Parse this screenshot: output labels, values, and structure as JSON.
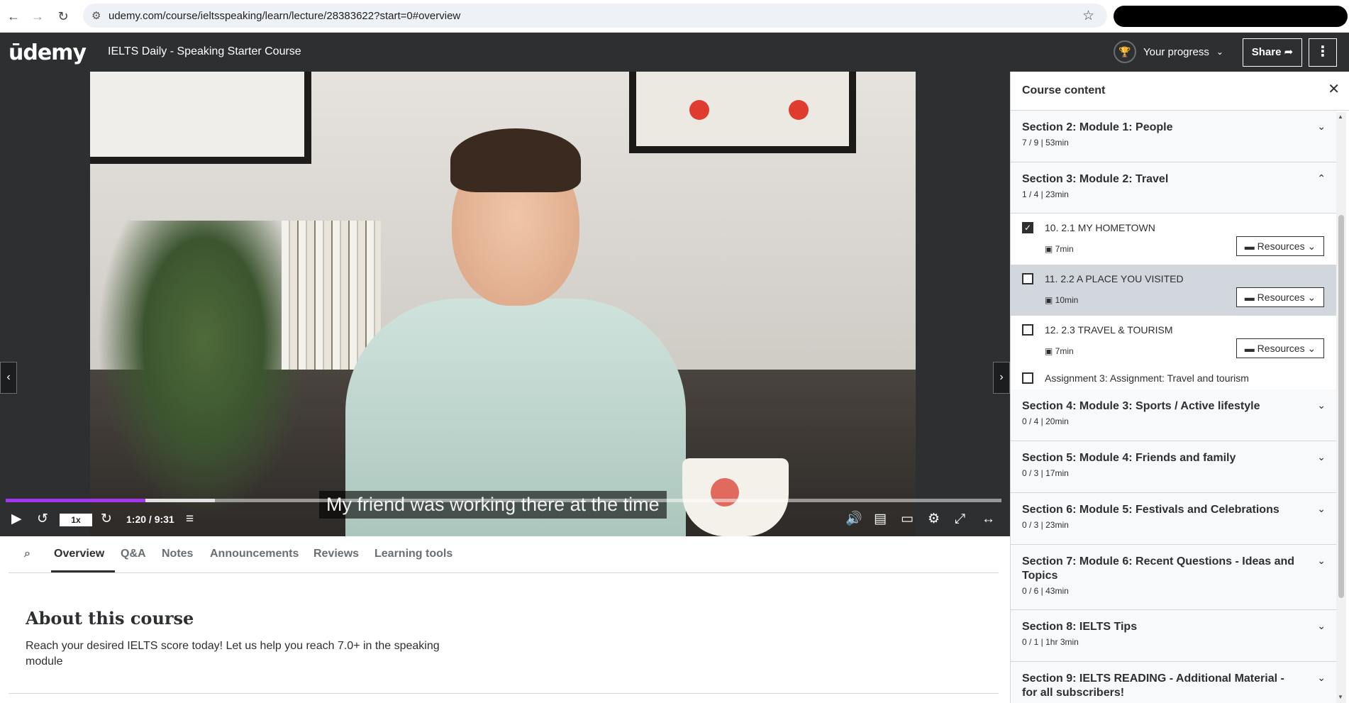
{
  "browser": {
    "url": "udemy.com/course/ieltsspeaking/learn/lecture/28383622?start=0#overview"
  },
  "header": {
    "logo": "ūdemy",
    "course_title": "IELTS Daily - Speaking Starter Course",
    "progress_label": "Your progress",
    "share_label": "Share",
    "more_label": "⋮"
  },
  "player": {
    "subtitle": "My friend was working there at the time",
    "speed": "1x",
    "time": "1:20 / 9:31",
    "progress_fraction": 0.14,
    "buffer_fraction": 0.21
  },
  "tabs": [
    "Overview",
    "Q&A",
    "Notes",
    "Announcements",
    "Reviews",
    "Learning tools"
  ],
  "about": {
    "title": "About this course",
    "text": "Reach your desired IELTS score today! Let us help you reach 7.0+ in the speaking module"
  },
  "sidebar": {
    "title": "Course content",
    "sections": [
      {
        "title": "Section 2: Module 1: People",
        "sub": "7 / 9 | 53min",
        "expanded": false
      },
      {
        "title": "Section 3: Module 2: Travel",
        "sub": "1 / 4 | 23min",
        "expanded": true
      },
      {
        "title": "Section 4: Module 3: Sports / Active lifestyle",
        "sub": "0 / 4 | 20min",
        "expanded": false
      },
      {
        "title": "Section 5: Module 4: Friends and family",
        "sub": "0 / 3 | 17min",
        "expanded": false
      },
      {
        "title": "Section 6: Module 5: Festivals and Celebrations",
        "sub": "0 / 3 | 23min",
        "expanded": false
      },
      {
        "title": "Section 7: Module 6: Recent Questions - Ideas and Topics",
        "sub": "0 / 6 | 43min",
        "expanded": false
      },
      {
        "title": "Section 8: IELTS Tips",
        "sub": "0 / 1 | 1hr 3min",
        "expanded": false
      },
      {
        "title": "Section 9: IELTS READING - Additional Material - for all subscribers!",
        "sub": "",
        "expanded": false
      }
    ],
    "lectures": [
      {
        "title": "10. 2.1 MY HOMETOWN",
        "duration": "7min",
        "done": true,
        "resources": "Resources"
      },
      {
        "title": "11. 2.2 A PLACE YOU VISITED",
        "duration": "10min",
        "done": false,
        "resources": "Resources"
      },
      {
        "title": "12. 2.3 TRAVEL & TOURISM",
        "duration": "7min",
        "done": false,
        "resources": "Resources"
      },
      {
        "title": "Assignment 3: Assignment: Travel and tourism",
        "duration": "",
        "done": false,
        "resources": ""
      }
    ]
  }
}
